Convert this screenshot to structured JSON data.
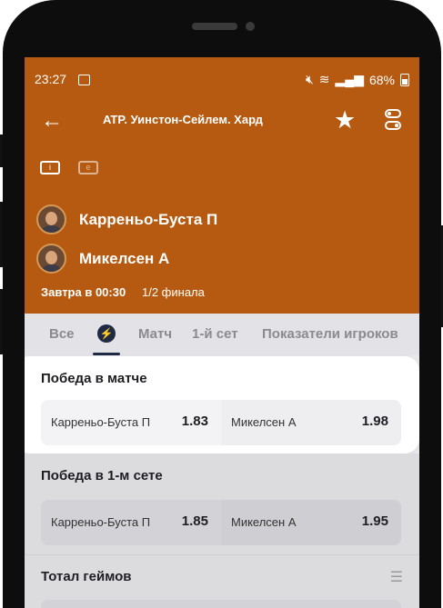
{
  "status_bar": {
    "time": "23:27",
    "battery": "68%"
  },
  "header": {
    "back_icon": "back-arrow-icon",
    "title": "ATP. Уинстон-Сейлем. Хард",
    "video_icon_label": "i",
    "text_icon_label": "e"
  },
  "match": {
    "player1": "Карреньо-Буста П",
    "player2": "Микелсен А",
    "when": "Завтра в 00:30",
    "stage": "1/2 финала"
  },
  "tabs": [
    {
      "label": "Все"
    },
    {
      "label": "⚡"
    },
    {
      "label": "Матч"
    },
    {
      "label": "1-й сет"
    },
    {
      "label": "Показатели игроков"
    }
  ],
  "markets": [
    {
      "title": "Победа в матче",
      "outcomes": [
        {
          "name": "Карреньо-Буста П",
          "odd": "1.83"
        },
        {
          "name": "Микелсен А",
          "odd": "1.98"
        }
      ]
    },
    {
      "title": "Победа в 1-м сете",
      "outcomes": [
        {
          "name": "Карреньо-Буста П",
          "odd": "1.85"
        },
        {
          "name": "Микелсен А",
          "odd": "1.95"
        }
      ]
    },
    {
      "title": "Тотал геймов"
    }
  ],
  "colors": {
    "header_bg": "#b55a10",
    "accent_dark": "#1f2a44"
  }
}
